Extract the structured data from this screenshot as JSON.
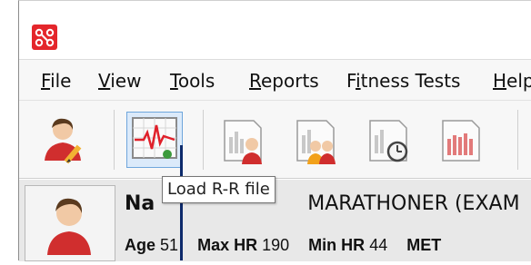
{
  "menu": {
    "items": [
      {
        "label": "File",
        "accel_index": 0
      },
      {
        "label": "View",
        "accel_index": 0
      },
      {
        "label": "Tools",
        "accel_index": 0
      },
      {
        "label": "Reports",
        "accel_index": 0
      },
      {
        "label": "Fitness Tests",
        "accel_index": 1
      },
      {
        "label": "Help",
        "accel_index": 0
      }
    ]
  },
  "toolbar": {
    "buttons": [
      {
        "icon": "edit-user-icon"
      },
      {
        "icon": "ecg-chart-icon",
        "active": true
      },
      {
        "icon": "report-user-icon"
      },
      {
        "icon": "report-group-icon"
      },
      {
        "icon": "report-timer-icon"
      },
      {
        "icon": "report-bars-icon"
      }
    ]
  },
  "tooltip": {
    "text": "Load R-R file"
  },
  "profile": {
    "name_label": "Na",
    "name_value": "MARATHONER (EXAM",
    "stats": [
      {
        "label": "Age",
        "value": "51"
      },
      {
        "label": "Max HR",
        "value": "190"
      },
      {
        "label": "Min HR",
        "value": "44"
      },
      {
        "label": "MET",
        "value": ""
      }
    ]
  },
  "colors": {
    "app_icon": "#e4262b",
    "active_button_bg": "#dbeafa",
    "ecg_line": "#e0202a",
    "pointer": "#0d2a6b"
  }
}
